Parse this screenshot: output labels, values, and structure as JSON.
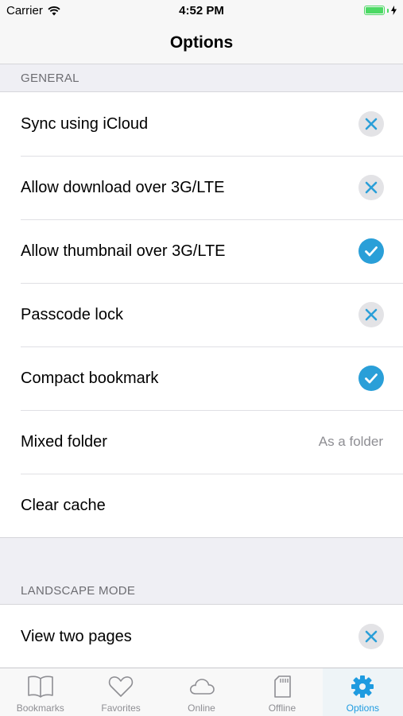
{
  "status_bar": {
    "carrier": "Carrier",
    "time": "4:52 PM",
    "battery_level": 1.0
  },
  "nav": {
    "title": "Options"
  },
  "sections": {
    "general": {
      "header": "GENERAL",
      "rows": [
        {
          "label": "Sync using iCloud",
          "state": "off"
        },
        {
          "label": "Allow download over 3G/LTE",
          "state": "off"
        },
        {
          "label": "Allow thumbnail over 3G/LTE",
          "state": "on"
        },
        {
          "label": "Passcode lock",
          "state": "off"
        },
        {
          "label": "Compact bookmark",
          "state": "on"
        },
        {
          "label": "Mixed folder",
          "value": "As a folder"
        },
        {
          "label": "Clear cache"
        }
      ]
    },
    "landscape": {
      "header": "LANDSCAPE MODE",
      "rows": [
        {
          "label": "View two pages",
          "state": "off"
        }
      ]
    }
  },
  "tabs": [
    {
      "label": "Bookmarks",
      "icon": "book-icon",
      "active": false
    },
    {
      "label": "Favorites",
      "icon": "heart-icon",
      "active": false
    },
    {
      "label": "Online",
      "icon": "cloud-icon",
      "active": false
    },
    {
      "label": "Offline",
      "icon": "sd-card-icon",
      "active": false
    },
    {
      "label": "Options",
      "icon": "gear-icon",
      "active": true
    }
  ],
  "colors": {
    "accent": "#1e9be0",
    "toggle_on": "#2a9fd8",
    "toggle_off_bg": "#e3e3e6",
    "battery": "#4cd964"
  }
}
